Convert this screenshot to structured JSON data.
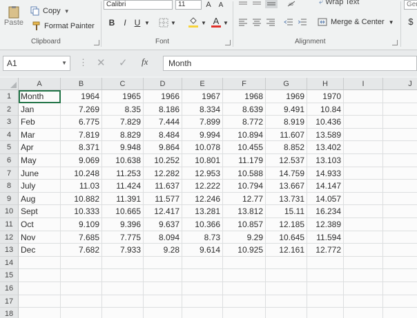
{
  "ribbon": {
    "paste_label": "Paste",
    "copy_label": "Copy",
    "format_painter_label": "Format Painter",
    "clipboard_group": "Clipboard",
    "font_name": "Calibri",
    "font_size": "11",
    "font_group": "Font",
    "bold": "B",
    "italic": "I",
    "underline": "U",
    "grow_font": "A",
    "shrink_font": "A",
    "font_color_letter": "A",
    "wrap_text_label": "Wrap Text",
    "merge_center_label": "Merge & Center",
    "alignment_group": "Alignment",
    "number_format_partial": "Ger",
    "currency_symbol": "$",
    "font_color_bar": "#e0302a",
    "fill_color_bar": "#f7d33a"
  },
  "formula_bar": {
    "name_box": "A1",
    "fx": "fx",
    "value": "Month"
  },
  "sheet": {
    "columns": [
      "A",
      "B",
      "C",
      "D",
      "E",
      "F",
      "G",
      "H",
      "I",
      "J"
    ],
    "rows": [
      [
        "Month",
        "1964",
        "1965",
        "1966",
        "1967",
        "1968",
        "1969",
        "1970"
      ],
      [
        "Jan",
        "7.269",
        "8.35",
        "8.186",
        "8.334",
        "8.639",
        "9.491",
        "10.84"
      ],
      [
        "Feb",
        "6.775",
        "7.829",
        "7.444",
        "7.899",
        "8.772",
        "8.919",
        "10.436"
      ],
      [
        "Mar",
        "7.819",
        "8.829",
        "8.484",
        "9.994",
        "10.894",
        "11.607",
        "13.589"
      ],
      [
        "Apr",
        "8.371",
        "9.948",
        "9.864",
        "10.078",
        "10.455",
        "8.852",
        "13.402"
      ],
      [
        "May",
        "9.069",
        "10.638",
        "10.252",
        "10.801",
        "11.179",
        "12.537",
        "13.103"
      ],
      [
        "June",
        "10.248",
        "11.253",
        "12.282",
        "12.953",
        "10.588",
        "14.759",
        "14.933"
      ],
      [
        "July",
        "11.03",
        "11.424",
        "11.637",
        "12.222",
        "10.794",
        "13.667",
        "14.147"
      ],
      [
        "Aug",
        "10.882",
        "11.391",
        "11.577",
        "12.246",
        "12.77",
        "13.731",
        "14.057"
      ],
      [
        "Sept",
        "10.333",
        "10.665",
        "12.417",
        "13.281",
        "13.812",
        "15.11",
        "16.234"
      ],
      [
        "Oct",
        "9.109",
        "9.396",
        "9.637",
        "10.366",
        "10.857",
        "12.185",
        "12.389"
      ],
      [
        "Nov",
        "7.685",
        "7.775",
        "8.094",
        "8.73",
        "9.29",
        "10.645",
        "11.594"
      ],
      [
        "Dec",
        "7.682",
        "7.933",
        "9.28",
        "9.614",
        "10.925",
        "12.161",
        "12.772"
      ]
    ],
    "row_numbers": [
      "1",
      "2",
      "3",
      "4",
      "5",
      "6",
      "7",
      "8",
      "9",
      "10",
      "11",
      "12",
      "13",
      "14",
      "15",
      "16",
      "17",
      "18"
    ],
    "accent": "#217346"
  }
}
